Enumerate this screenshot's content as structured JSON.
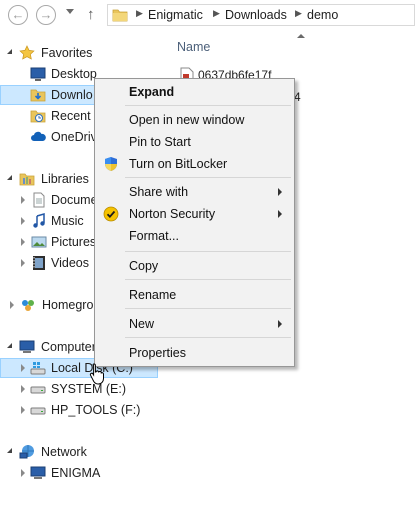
{
  "address_bar": {
    "crumbs": [
      "Enigmatic",
      "Downloads",
      "demo"
    ]
  },
  "nav": {
    "items": [
      {
        "label": "Favorites",
        "icon": "star-icon"
      },
      {
        "label": "Desktop",
        "icon": "desktop-icon"
      },
      {
        "label": "Downlo",
        "icon": "downloads-folder-icon"
      },
      {
        "label": "Recent p",
        "icon": "recent-places-icon"
      },
      {
        "label": "OneDriv",
        "icon": "onedrive-icon"
      },
      {
        "label": "Libraries",
        "icon": "libraries-icon"
      },
      {
        "label": "Docume",
        "icon": "documents-icon"
      },
      {
        "label": "Music",
        "icon": "music-icon"
      },
      {
        "label": "Pictures",
        "icon": "pictures-icon"
      },
      {
        "label": "Videos",
        "icon": "videos-icon"
      },
      {
        "label": "Homegro",
        "icon": "homegroup-icon"
      },
      {
        "label": "Computer",
        "icon": "computer-icon"
      },
      {
        "label": "Local Disk (C:)",
        "icon": "drive-c-icon"
      },
      {
        "label": "SYSTEM (E:)",
        "icon": "drive-icon"
      },
      {
        "label": "HP_TOOLS (F:)",
        "icon": "drive-icon"
      },
      {
        "label": "Network",
        "icon": "network-icon"
      },
      {
        "label": "ENIGMA",
        "icon": "network-computer-icon"
      }
    ]
  },
  "content": {
    "column_name": "Name",
    "file1": "0637db6fe17f",
    "file2_fragment": "4"
  },
  "context_menu": {
    "items": {
      "expand": "Expand",
      "open_new_window": "Open in new window",
      "pin_to_start": "Pin to Start",
      "bitlocker": "Turn on BitLocker",
      "share_with": "Share with",
      "norton": "Norton Security",
      "format": "Format...",
      "copy": "Copy",
      "rename": "Rename",
      "new": "New",
      "properties": "Properties"
    }
  },
  "colors": {
    "selection_bg": "#cce8ff",
    "selection_border": "#99d1ff",
    "menu_bg": "#f2f2f2"
  }
}
